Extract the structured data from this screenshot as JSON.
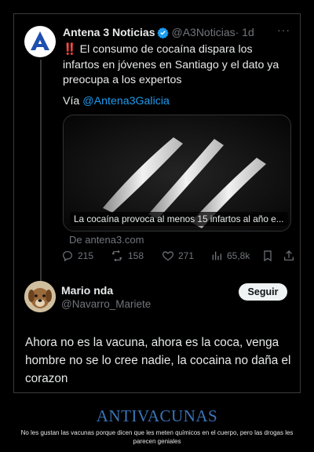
{
  "tweet": {
    "display_name": "Antena 3 Noticias",
    "handle": "@A3Noticias",
    "time": "· 1d",
    "text": "‼️ El consumo de cocaína dispara los infartos en jóvenes en Santiago y el dato ya preocupa a los expertos",
    "via_prefix": "Vía ",
    "via_link": "@Antena3Galicia",
    "card_caption": "La cocaína provoca al menos 15 infartos al año e...",
    "source": "De antena3.com",
    "stats": {
      "replies": "215",
      "retweets": "158",
      "likes": "271",
      "views": "65,8k"
    }
  },
  "reply": {
    "display_name": "Mario nda",
    "handle": "@Navarro_Mariete",
    "follow_label": "Seguir",
    "text": "Ahora no es la vacuna, ahora es la coca, venga hombre no se lo cree nadie, la cocaina no daña el corazon"
  },
  "caption": {
    "title": "ANTIVACUNAS",
    "subtitle": "No les gustan las vacunas porque dicen que les meten químicos en el cuerpo, pero las drogas les parecen geniales"
  },
  "colors": {
    "link": "#1d9bf0",
    "verified": "#1d9bf0",
    "brand_blue": "#1e4fae",
    "caption_blue": "#3a74b8"
  }
}
